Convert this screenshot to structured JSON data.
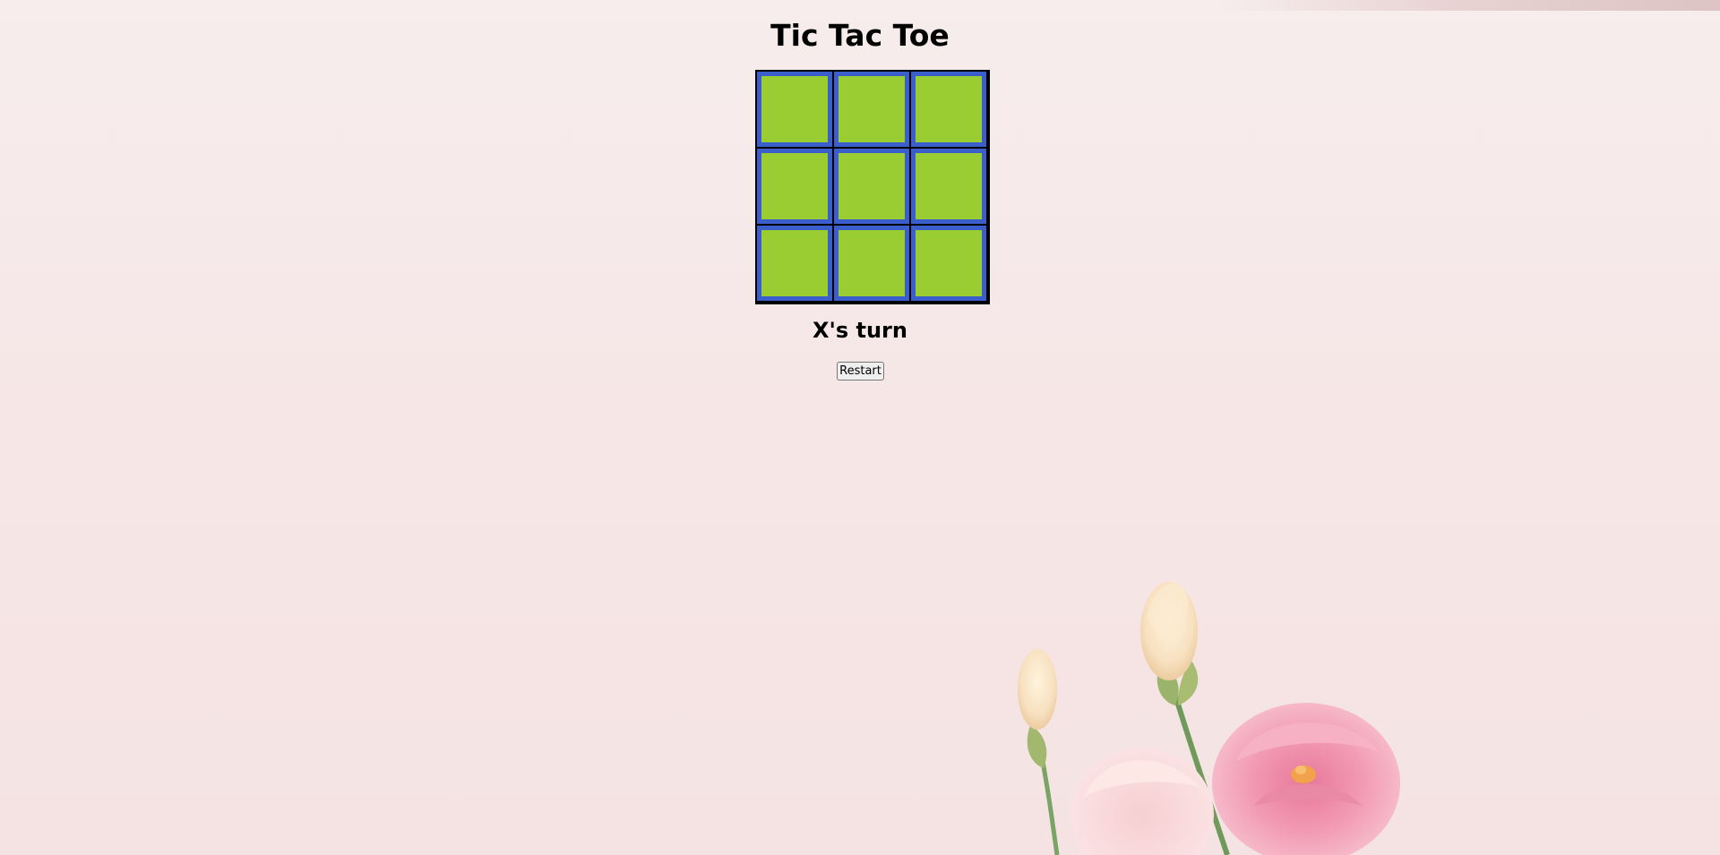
{
  "title": "Tic Tac Toe",
  "board": {
    "cells": [
      "",
      "",
      "",
      "",
      "",
      "",
      "",
      "",
      ""
    ]
  },
  "status": "X's turn",
  "restart_label": "Restart",
  "colors": {
    "cell_fill": "#9acd32",
    "cell_border": "#3a5fcd",
    "grid_lines": "#000000",
    "background": "#f6e6e6"
  }
}
